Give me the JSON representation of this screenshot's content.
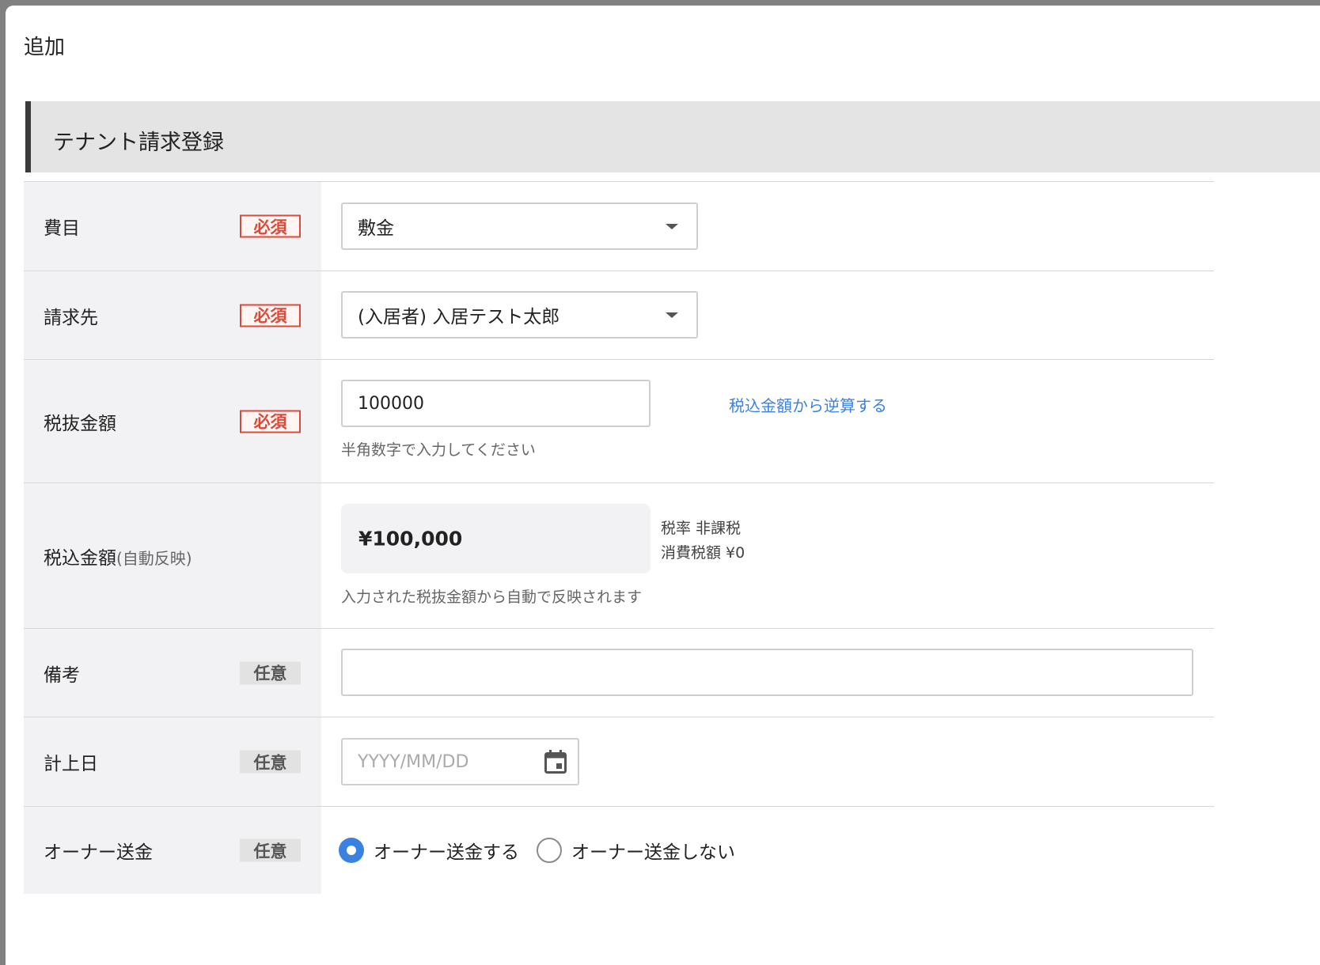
{
  "modal": {
    "title": "追加"
  },
  "section": {
    "title": "テナント請求登録"
  },
  "badges": {
    "required": "必須",
    "optional": "任意"
  },
  "fields": {
    "expense_item": {
      "label": "費目",
      "value": "敷金"
    },
    "billing_to": {
      "label": "請求先",
      "value": "(入居者) 入居テスト太郎"
    },
    "amount_excl_tax": {
      "label": "税抜金額",
      "value": "100000",
      "helper": "半角数字で入力してください",
      "reverse_calc_link": "税込金額から逆算する"
    },
    "amount_incl_tax": {
      "label": "税込金額",
      "label_sub": "(自動反映)",
      "value": "¥100,000",
      "tax_rate": "税率 非課税",
      "consumption_tax": "消費税額 ¥0",
      "helper": "入力された税抜金額から自動で反映されます"
    },
    "remarks": {
      "label": "備考",
      "value": ""
    },
    "posting_date": {
      "label": "計上日",
      "placeholder": "YYYY/MM/DD",
      "icon": "calendar-icon"
    },
    "owner_remittance": {
      "label": "オーナー送金",
      "options": [
        {
          "label": "オーナー送金する",
          "checked": true
        },
        {
          "label": "オーナー送金しない",
          "checked": false
        }
      ]
    }
  },
  "colors": {
    "required_badge": "#d94a3a",
    "link": "#3b82e0",
    "radio_checked": "#3b82e0",
    "label_cell_bg": "#f2f2f4",
    "section_header_bg": "#e4e4e4"
  }
}
